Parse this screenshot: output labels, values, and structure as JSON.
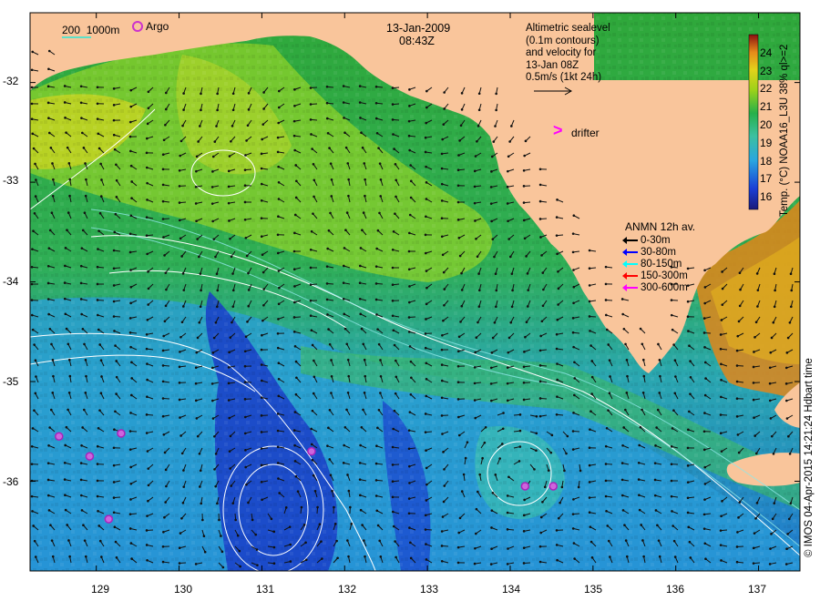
{
  "date_label": "13-Jan-2009",
  "time_label": "08:43Z",
  "scale_bar": {
    "labels": [
      "200",
      "1000m"
    ]
  },
  "argo_label": "Argo",
  "altimetry": {
    "lines": [
      "Altimetric sealevel",
      "(0.1m contours)",
      "and velocity for",
      "13-Jan 08Z",
      "0.5m/s (1kt 24h)"
    ]
  },
  "drifter": {
    "symbol": ">",
    "label": "drifter"
  },
  "anmn_legend": {
    "title": "ANMN 12h av.",
    "items": [
      {
        "label": "0-30m",
        "color": "#000000"
      },
      {
        "label": "30-80m",
        "color": "#0000ff"
      },
      {
        "label": "80-150m",
        "color": "#00ffff"
      },
      {
        "label": "150-300m",
        "color": "#ff0000"
      },
      {
        "label": "300-600m",
        "color": "#ff00ff"
      }
    ]
  },
  "colorbar": {
    "title": "Temp. (°C) NOAA16_L3U 38% ql>=2",
    "ticks": [
      "24",
      "23",
      "22",
      "21",
      "20",
      "19",
      "18",
      "17",
      "16"
    ],
    "range": [
      15.3,
      25.0
    ]
  },
  "credit": "© IMOS 04-Apr-2015 14:21:24 Hdbart time",
  "axes": {
    "x_ticks": [
      "129",
      "130",
      "131",
      "132",
      "133",
      "134",
      "135",
      "136",
      "137"
    ],
    "y_ticks": [
      "-32",
      "-33",
      "-34",
      "-35",
      "-36"
    ],
    "lon_range": [
      128.2,
      137.5
    ],
    "lat_range": [
      -36.9,
      -31.3
    ]
  },
  "argo_floats": [
    {
      "lon": 128.55,
      "lat": -35.55
    },
    {
      "lon": 128.92,
      "lat": -35.75
    },
    {
      "lon": 129.3,
      "lat": -35.52
    },
    {
      "lon": 129.15,
      "lat": -36.38
    },
    {
      "lon": 131.6,
      "lat": -35.7
    },
    {
      "lon": 134.18,
      "lat": -36.05
    },
    {
      "lon": 134.52,
      "lat": -36.05
    }
  ],
  "colors": {
    "land": "#f9c59b",
    "accent_argo": "#cc33cc",
    "drifter": "#ff00ff",
    "contour": "#ffffff"
  }
}
